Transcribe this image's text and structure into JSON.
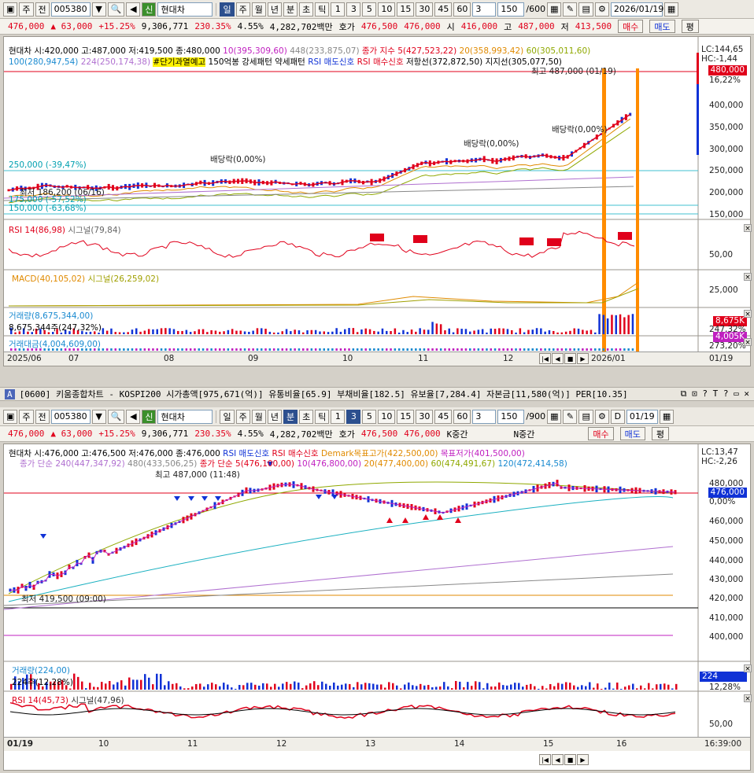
{
  "top": {
    "toolbar": {
      "market": "주",
      "all_btn": "전",
      "code": "005380",
      "search_icon": "search-icon",
      "stock_tag": "신",
      "stock_name": "현대차",
      "periods": [
        "일",
        "주",
        "월",
        "년"
      ],
      "intraday": [
        "분",
        "초",
        "틱"
      ],
      "intervals": [
        "1",
        "3",
        "5",
        "10",
        "15",
        "30",
        "45",
        "60"
      ],
      "count_val": "3",
      "bars": "150",
      "bars_max": "/600",
      "date": "2026/01/19"
    },
    "info": {
      "price": "476,000",
      "change": "▲ 63,000",
      "rate": "+15.25%",
      "volume": "9,306,771",
      "vol_ratio": "230.35%",
      "turnover": "4.55%",
      "amount": "4,282,702백만",
      "ask_label": "호가",
      "ask1": "476,500",
      "bid1": "476,000",
      "open_label": "시",
      "open": "416,000",
      "high_label": "고",
      "high": "487,000",
      "low_label": "저",
      "low": "413,500",
      "buy": "매수",
      "sell": "매도",
      "avg": "평"
    },
    "legend": {
      "ohlc": "현대차 시:420,000 고:487,000 저:419,500 종:480,000",
      "ma10": "10(395,309,60)",
      "ma448": "448(233,875,07)",
      "close_index": "종가 지수 5(427,523,22)",
      "ma20": "20(358,993,42)",
      "ma60": "60(305,011,60)",
      "ma100": "100(280,947,54)",
      "ma224": "224(250,174,38)",
      "short_overheat": "#단기과열예고",
      "bar150": "150억봉 강세패턴",
      "weak": "약세패턴",
      "rsi_sell": "RSI 매도신호",
      "rsi_buy": "RSI 매수신호",
      "resistance": "저항선(372,872,50)",
      "support": "지지선(305,077,50)"
    },
    "annotations": {
      "high": "최고 487,000 (01/19)",
      "div1": "배당락(0,00%)",
      "div2": "배당락(0,00%)",
      "div3": "배당락(0,00%)",
      "level250": "250,000 (-39,47%)",
      "level150": "150,000 (-63,68%)",
      "low": "최저 186,200 (06/16)",
      "low2": "175,000 (-57,52%)"
    },
    "right_axis": {
      "lc": "LC:144,65",
      "hc": "HC:-1,44",
      "current": "480,000",
      "pct": "16,22%",
      "ticks": [
        "400,000",
        "350,000",
        "300,000",
        "250,000",
        "200,000",
        "150,000"
      ]
    },
    "rsi": {
      "label": "RSI 14(86,98)",
      "signal": "시그널(79,84)",
      "tick": "50,00"
    },
    "macd": {
      "label": "MACD(40,105,02)",
      "signal": "시그널(26,259,02)",
      "tick": "25,000"
    },
    "volume": {
      "label": "거래량(8,675,344,00)",
      "sub": "8,675,344주(247,32%)",
      "tag": "8,675K",
      "tag2": "247,32%"
    },
    "amount": {
      "label": "거래대금(4,004,609,00)",
      "tag": "4,005K",
      "tag2": "273,20%"
    },
    "x_axis": [
      "2025/06",
      "07",
      "08",
      "09",
      "10",
      "11",
      "12",
      "2026/01"
    ],
    "x_right": "01/19"
  },
  "bottom": {
    "titlebar": "[0600] 키움종합차트 - KOSPI200 시가총액[975,671(억)] 유통비율[65.9] 부채비율[182.5] 유보율[7,284.4] 자본금[11,580(억)] PER[10.35]",
    "toolbar": {
      "market": "주",
      "all_btn": "전",
      "code": "005380",
      "stock_tag": "신",
      "stock_name": "현대차",
      "periods": [
        "일",
        "주",
        "월",
        "년"
      ],
      "intraday": [
        "분",
        "초",
        "틱"
      ],
      "intervals": [
        "1",
        "3",
        "5",
        "10",
        "15",
        "30",
        "45",
        "60"
      ],
      "count_val": "3",
      "bars": "150",
      "bars_max": "/900",
      "check_d": "D",
      "date": "01/19"
    },
    "info": {
      "price": "476,000",
      "change": "▲ 63,000",
      "rate": "+15.25%",
      "volume": "9,306,771",
      "vol_ratio": "230.35%",
      "turnover": "4.55%",
      "amount": "4,282,702백만",
      "ask_label": "호가",
      "ask1": "476,500",
      "bid1": "476,000",
      "k_mid": "K중간",
      "n_mid": "N중간",
      "buy": "매수",
      "sell": "매도",
      "avg": "평"
    },
    "legend": {
      "ohlc": "현대차 시:476,000 고:476,500 저:476,000 종:476,000",
      "rsi_sell": "RSI 매도신호",
      "rsi_buy": "RSI 매수신호",
      "demark_high": "Demark목표고가(422,500,00)",
      "target_low": "목표저가(401,500,00)",
      "close_simple": "종가 단순 240(447,347,92)",
      "ma480": "480(433,506,25)",
      "close_simple5": "종가 단순 5(476,100,00)",
      "ma10": "10(476,800,00)",
      "ma20": "20(477,400,00)",
      "ma60": "60(474,491,67)",
      "ma120": "120(472,414,58)"
    },
    "annotations": {
      "high": "최고 487,000 (11:48)",
      "low": "최저 419,500 (09:00)"
    },
    "right_axis": {
      "lc": "LC:13,47",
      "hc": "HC:-2,26",
      "current": "476,000",
      "pct": "0,00%",
      "ticks": [
        "480,000",
        "470,000",
        "460,000",
        "450,000",
        "440,000",
        "430,000",
        "420,000",
        "410,000",
        "400,000"
      ]
    },
    "volume": {
      "label": "거래량(224,00)",
      "sub": "224주(12,28%)",
      "tag": "224",
      "tag2": "12,28%"
    },
    "rsi": {
      "label": "RSI 14(45,73)",
      "signal": "시그널(47,96)",
      "tick": "50,00"
    },
    "x_axis": [
      "01/19",
      "10",
      "11",
      "12",
      "13",
      "14",
      "15",
      "16"
    ],
    "x_right": "16:39:00"
  },
  "colors": {
    "up": "#e0001b",
    "down": "#1032d6",
    "orange": "#ff8c00",
    "accent": "#2c4f8e"
  }
}
